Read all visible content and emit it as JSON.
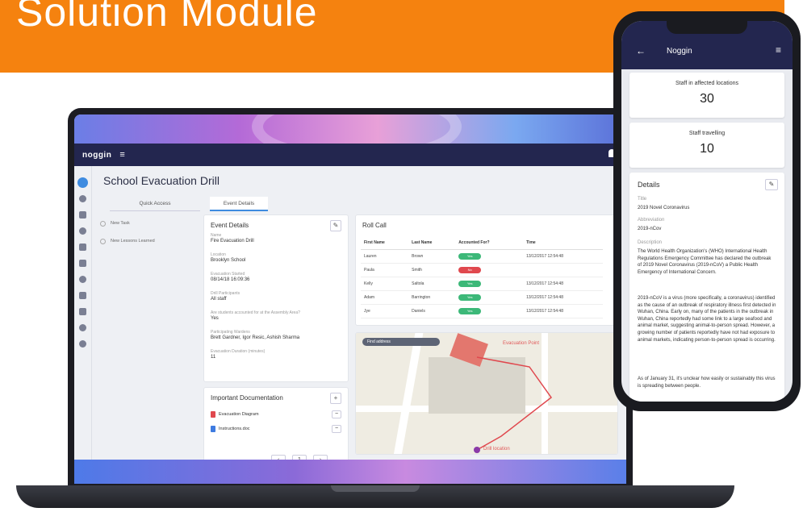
{
  "banner": {
    "title": "Solution Module",
    "color": "#f5820f"
  },
  "laptop": {
    "app": {
      "logo": "noggin",
      "menu_icon": "≡"
    },
    "page_title": "School Evacuation Drill",
    "tabs": [
      {
        "label": "Quick Access"
      },
      {
        "label": "Event Details"
      }
    ],
    "quick_access": [
      {
        "label": "New Task"
      },
      {
        "label": "New Lessons Learned"
      }
    ],
    "event_details": {
      "title": "Event Details",
      "fields": [
        {
          "label": "Name",
          "value": "Fire Evacuation Drill"
        },
        {
          "label": "Location",
          "value": "Brooklyn School"
        },
        {
          "label": "Evacuation Started",
          "value": "08/14/18 16:09:36"
        },
        {
          "label": "Drill Participants",
          "value": "All staff"
        },
        {
          "label": "Are students accounted for at the Assembly Area?",
          "value": "Yes"
        },
        {
          "label": "Participating Wardens",
          "value": "Brett Gardner, Igor Resic, Ashish Sharma"
        },
        {
          "label": "Evacuation Duration (minutes)",
          "value": "11"
        }
      ]
    },
    "roll_call": {
      "title": "Roll Call",
      "columns": [
        "First Name",
        "Last Name",
        "Accounted For?",
        "Time"
      ],
      "rows": [
        {
          "first": "Lauren",
          "last": "Brown",
          "status": "Yes",
          "time": "13/12/2017 12:54:48"
        },
        {
          "first": "Paula",
          "last": "Smith",
          "status": "No",
          "time": ""
        },
        {
          "first": "Kelly",
          "last": "Saltola",
          "status": "Yes",
          "time": "13/12/2017 12:54:48"
        },
        {
          "first": "Adam",
          "last": "Barrington",
          "status": "Yes",
          "time": "13/12/2017 12:54:48"
        },
        {
          "first": "Jye",
          "last": "Daniels",
          "status": "Yes",
          "time": "13/12/2017 12:54:48"
        }
      ]
    },
    "map": {
      "search_placeholder": "Find address",
      "evac_label": "Evacuation Point",
      "drill_label": "Drill location"
    },
    "documents": {
      "title": "Important Documentation",
      "items": [
        {
          "name": "Evacuation Diagram",
          "type": "pdf"
        },
        {
          "name": "Instructions.doc",
          "type": "doc"
        }
      ],
      "page": "1"
    },
    "status_colors": {
      "yes": "#3cb878",
      "no": "#e0484e",
      "accent": "#3e8be0"
    }
  },
  "phone": {
    "title": "Noggin",
    "stats": [
      {
        "label": "Staff in affected locations",
        "value": "30"
      },
      {
        "label": "Staff travelling",
        "value": "10"
      }
    ],
    "details": {
      "title": "Details",
      "fields": [
        {
          "label": "Title",
          "value": "2019 Novel Coronavirus"
        },
        {
          "label": "Abbreviation",
          "value": "2019-nCov"
        },
        {
          "label": "Description",
          "value": "The World Health Organization's (WHO) International Health Regulations Emergency Committee has declared the outbreak of 2019 Novel Coronavirus (2019-nCoV) a Public Health Emergency of International Concern."
        }
      ],
      "para2": "2019-nCoV is a virus (more specifically, a coronavirus) identified as the cause of an outbreak of respiratory illness first detected in Wuhan, China. Early on, many of the patients in the outbreak in Wuhan, China reportedly had some link to a large seafood and animal market, suggesting animal-to-person spread. However, a growing number of patients reportedly have not had exposure to animal markets, indicating person-to-person spread is occurring.",
      "para3": "As of January 31, it's unclear how easily or sustainably this virus is spreading between people."
    }
  }
}
